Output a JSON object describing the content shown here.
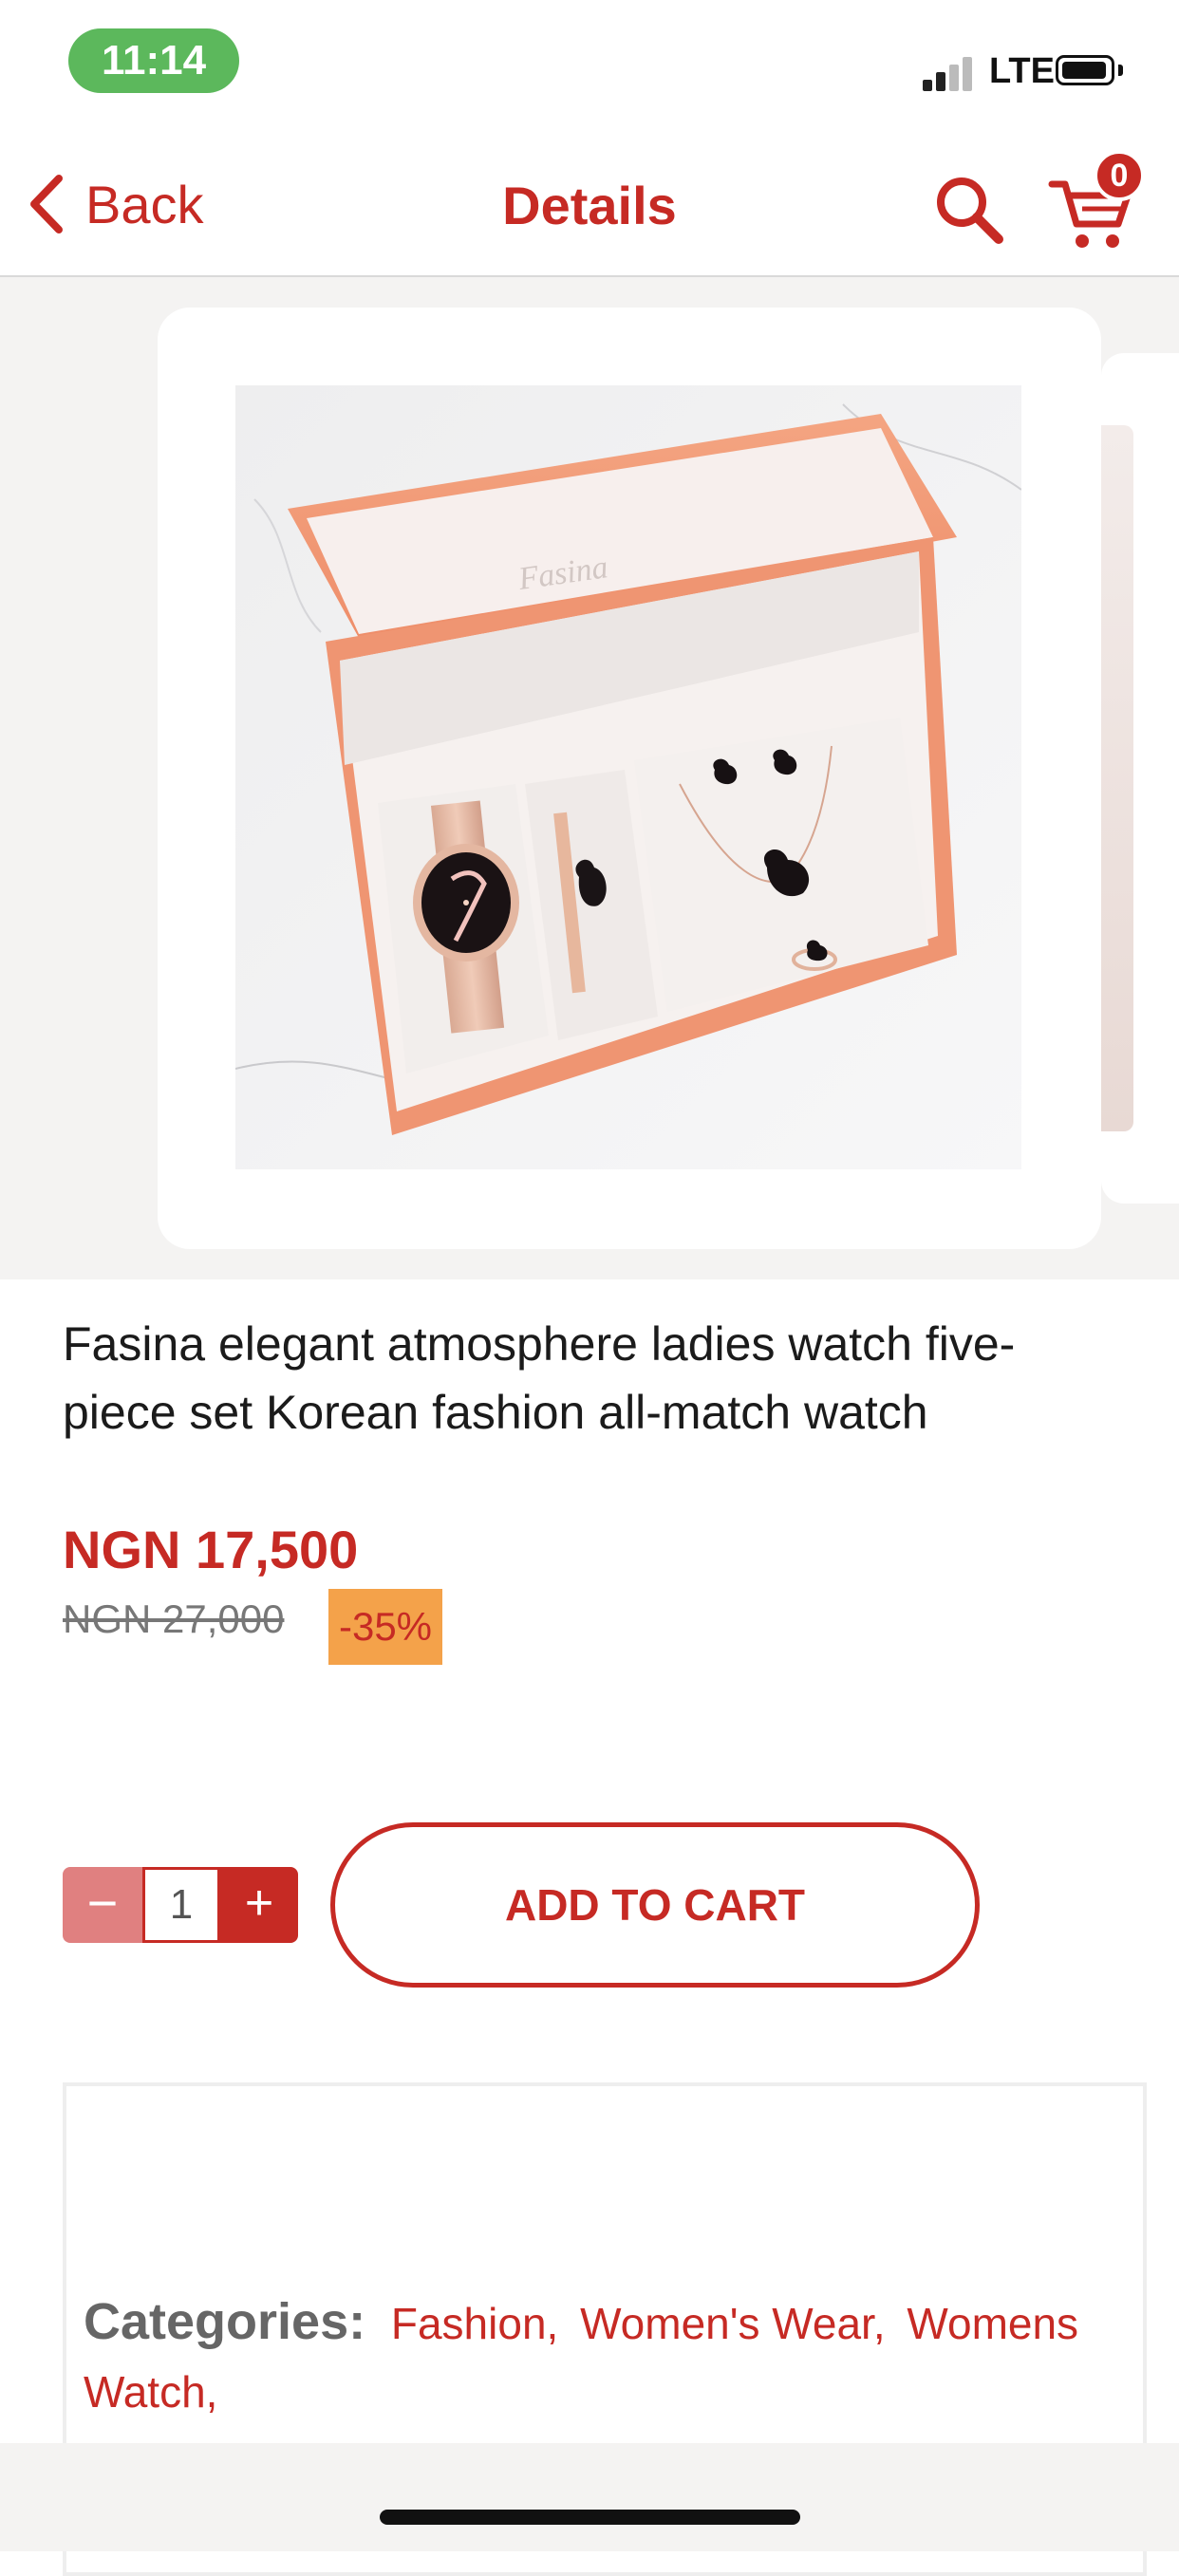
{
  "status_bar": {
    "time": "11:14",
    "carrier": "LTE",
    "time_pill_color": "#5cb85c"
  },
  "nav": {
    "back_label": "Back",
    "title": "Details",
    "cart_count": "0",
    "accent_color": "#c62a24",
    "icons": [
      "chevron-left-icon",
      "search-icon",
      "cart-icon"
    ]
  },
  "product": {
    "title": "Fasina elegant atmosphere ladies watch five-piece set Korean fashion all-match watch",
    "image_brand_text": "Fasina",
    "price": "NGN 17,500",
    "old_price": "NGN 27,000",
    "discount": "-35%"
  },
  "purchase": {
    "minus_label": "−",
    "quantity": "1",
    "plus_label": "+",
    "add_to_cart_label": "ADD TO CART"
  },
  "info": {
    "categories_label": "Categories:",
    "categories": [
      "Fashion,",
      "Women's Wear,",
      "Womens Watch,"
    ]
  }
}
